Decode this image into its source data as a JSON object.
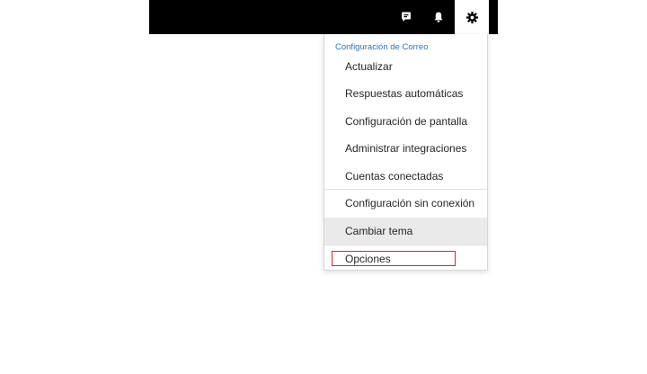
{
  "topbar": {
    "icons": [
      "chat-icon",
      "bell-icon",
      "gear-icon"
    ]
  },
  "settings_menu": {
    "header": "Configuración de Correo",
    "items": [
      {
        "label": "Actualizar"
      },
      {
        "label": "Respuestas automáticas"
      },
      {
        "label": "Configuración de pantalla"
      },
      {
        "label": "Administrar integraciones"
      },
      {
        "label": "Cuentas conectadas"
      },
      {
        "label": "Configuración sin conexión"
      },
      {
        "label": "Cambiar tema",
        "state": "hovered"
      },
      {
        "label": "Opciones",
        "state": "highlighted"
      }
    ]
  },
  "colors": {
    "topbar_bg": "#000000",
    "header_text": "#2b73c6",
    "highlight_border": "#e0202a",
    "hover_bg": "#eaeaea"
  }
}
